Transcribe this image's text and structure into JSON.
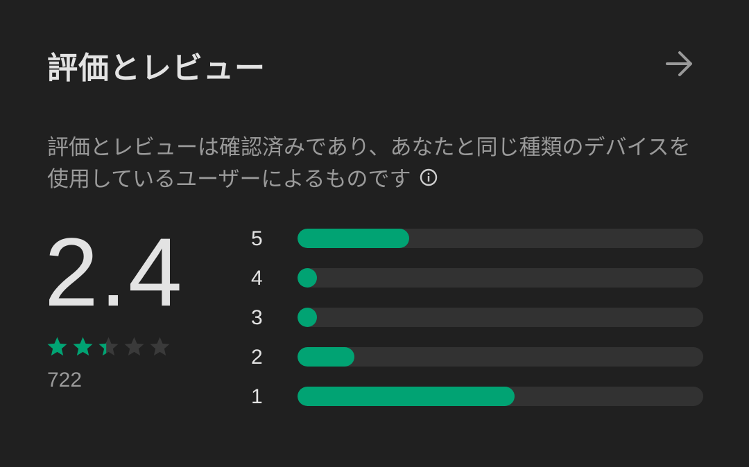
{
  "header": {
    "title": "評価とレビュー"
  },
  "description": "評価とレビューは確認済みであり、あなたと同じ種類のデバイスを使用しているユーザーによるものです",
  "rating": {
    "score": "2.4",
    "stars": 2.4,
    "count": "722"
  },
  "distribution": [
    {
      "label": "5",
      "fraction": 0.275
    },
    {
      "label": "4",
      "fraction": 0.03
    },
    {
      "label": "3",
      "fraction": 0.03
    },
    {
      "label": "2",
      "fraction": 0.14
    },
    {
      "label": "1",
      "fraction": 0.535
    }
  ],
  "colors": {
    "accent": "#01a373",
    "track": "#323232",
    "background": "#202020",
    "empty_star": "#3a3a3a"
  },
  "icons": {
    "arrow": "arrow-right-icon",
    "info": "info-icon",
    "star": "star-icon"
  }
}
